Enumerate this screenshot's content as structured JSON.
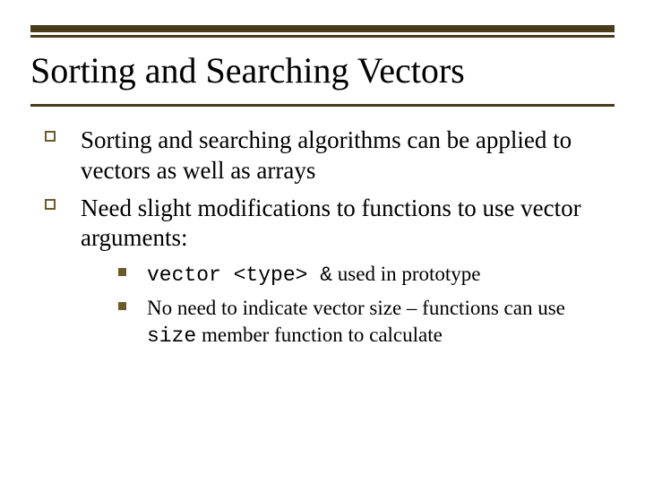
{
  "title": "Sorting and Searching Vectors",
  "bullets": {
    "b1": "Sorting and searching algorithms can be applied to vectors as well as arrays",
    "b2": "Need slight modifications to functions to use vector arguments:",
    "sub1_code": "vector <type> &",
    "sub1_tail": " used in prototype",
    "sub2_pre": "No need to indicate vector size – functions can use ",
    "sub2_code": "size",
    "sub2_post": " member function to calculate"
  }
}
